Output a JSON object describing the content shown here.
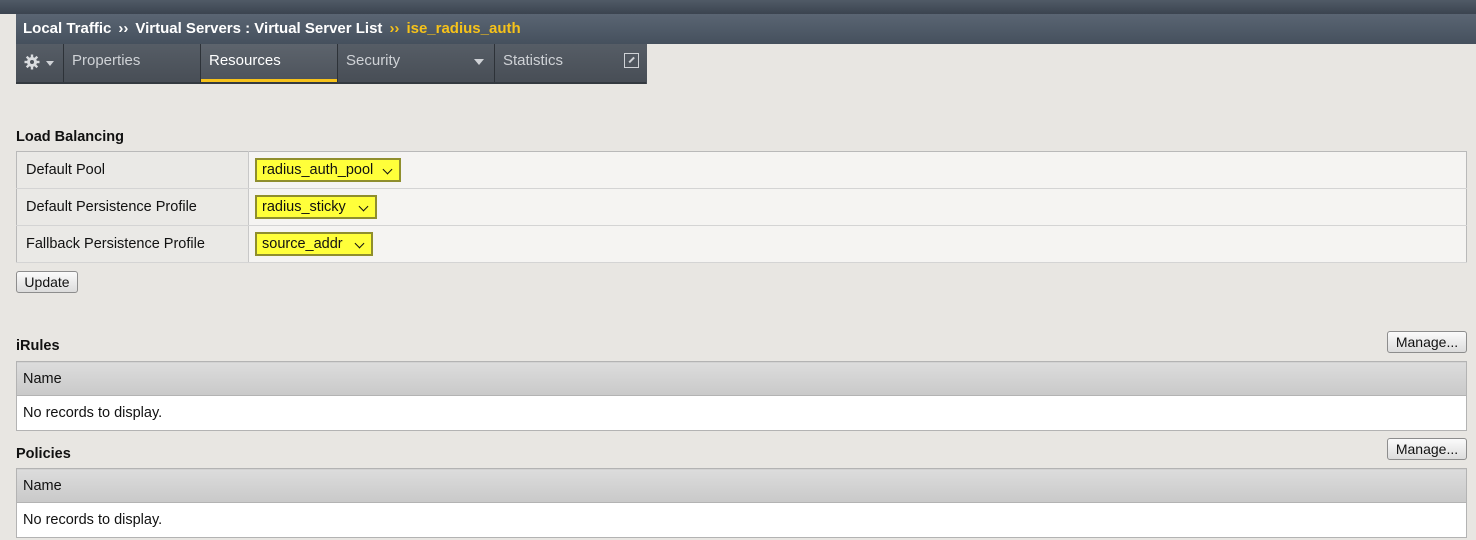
{
  "breadcrumb": {
    "items": [
      "Local Traffic",
      "Virtual Servers : Virtual Server List"
    ],
    "separator": "››",
    "current": "ise_radius_auth"
  },
  "tabs": [
    {
      "label": "",
      "icon": "gear-icon"
    },
    {
      "label": "Properties"
    },
    {
      "label": "Resources",
      "active": true
    },
    {
      "label": "Security",
      "has_dropdown": true
    },
    {
      "label": "Statistics",
      "icon": "popout-icon"
    }
  ],
  "load_balancing": {
    "title": "Load Balancing",
    "rows": [
      {
        "label": "Default Pool",
        "value": "radius_auth_pool"
      },
      {
        "label": "Default Persistence Profile",
        "value": "radius_sticky"
      },
      {
        "label": "Fallback Persistence Profile",
        "value": "source_addr"
      }
    ],
    "update_label": "Update"
  },
  "irules": {
    "title": "iRules",
    "manage_label": "Manage...",
    "column": "Name",
    "empty": "No records to display."
  },
  "policies": {
    "title": "Policies",
    "manage_label": "Manage...",
    "column": "Name",
    "empty": "No records to display."
  },
  "colors": {
    "accent": "#f6c21a",
    "highlight": "#ffff3a",
    "titlebar": "#4f5a66"
  }
}
